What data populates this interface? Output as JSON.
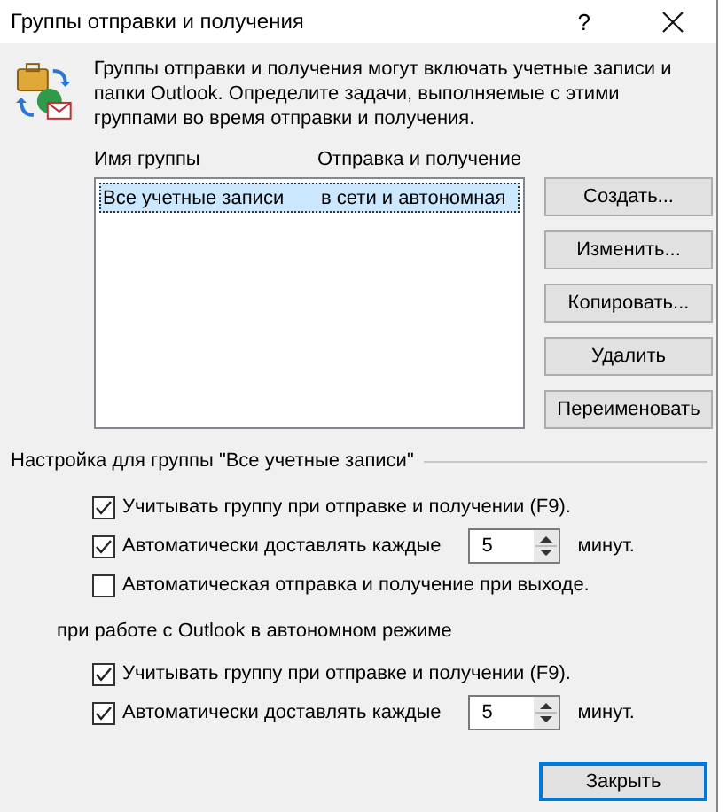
{
  "window": {
    "title": "Группы отправки и получения",
    "help": "?"
  },
  "description": "Группы отправки и получения могут включать учетные записи и папки Outlook. Определите задачи, выполняемые с этими группами во время отправки и получения.",
  "list": {
    "columns": [
      "Имя группы",
      "Отправка и получение"
    ],
    "rows": [
      {
        "cells": [
          "Все учетные записи",
          "в сети и автономная"
        ],
        "selected": true
      }
    ]
  },
  "buttons": [
    "Создать...",
    "Изменить...",
    "Копировать...",
    "Удалить",
    "Переименовать"
  ],
  "group_settings": {
    "title": "Настройка для группы \"Все учетные записи\"",
    "options": [
      {
        "kind": "checkbox",
        "label": "Учитывать группу при отправке и получении (F9).",
        "checked": true
      },
      {
        "kind": "interval",
        "label": "Автоматически доставлять каждые",
        "checked": true,
        "value": "5",
        "unit": "минут."
      },
      {
        "kind": "checkbox",
        "label": "Автоматическая отправка и получение при выходе.",
        "checked": false
      }
    ]
  },
  "offline_settings": {
    "title": "при работе с Outlook в автономном режиме",
    "options": [
      {
        "kind": "checkbox",
        "label": "Учитывать группу при отправке и получении (F9).",
        "checked": true
      },
      {
        "kind": "interval",
        "label": "Автоматически доставлять каждые",
        "checked": true,
        "value": "5",
        "unit": "минут."
      }
    ]
  },
  "close_button": "Закрыть"
}
